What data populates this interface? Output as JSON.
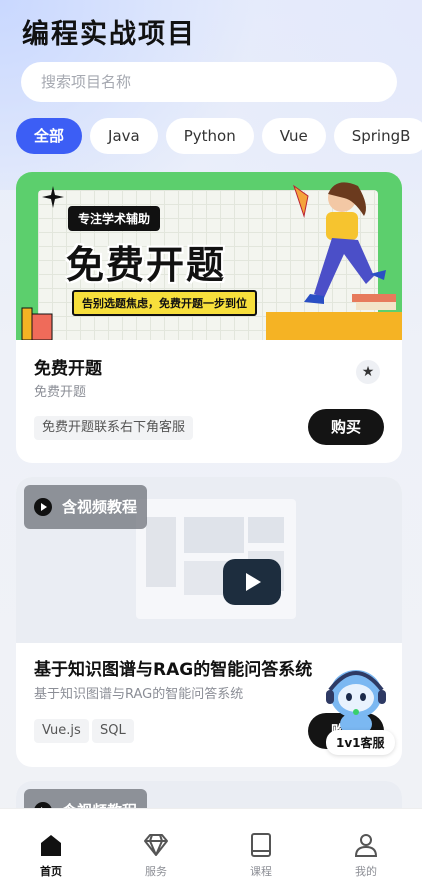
{
  "header": {
    "title": "编程实战项目"
  },
  "search": {
    "placeholder": "搜索项目名称"
  },
  "categories": [
    "全部",
    "Java",
    "Python",
    "Vue",
    "SpringB"
  ],
  "cards": [
    {
      "banner": {
        "tag": "专注学术辅助",
        "headline": "免费开题",
        "sub": "告别选题焦虑，免费开题一步到位"
      },
      "title": "免费开题",
      "subtitle": "免费开题",
      "tags": [
        "免费开题联系右下角客服"
      ],
      "buy": "购买",
      "star_icon": "star-icon"
    },
    {
      "badge": "含视频教程",
      "title": "基于知识图谱与RAG的智能问答系统",
      "subtitle": "基于知识图谱与RAG的智能问答系统",
      "tags": [
        "Vue.js",
        "SQL"
      ],
      "buy": "购买"
    },
    {
      "badge": "含视频教程"
    }
  ],
  "support": {
    "label": "1v1客服"
  },
  "tabbar": [
    {
      "label": "首页",
      "icon": "home-icon",
      "active": true
    },
    {
      "label": "服务",
      "icon": "diamond-icon",
      "active": false
    },
    {
      "label": "课程",
      "icon": "book-icon",
      "active": false
    },
    {
      "label": "我的",
      "icon": "user-icon",
      "active": false
    }
  ],
  "colors": {
    "accent": "#3c5ef5",
    "buy": "#141414",
    "banner_green": "#5ccf6d",
    "banner_yellow": "#f7df3c"
  }
}
